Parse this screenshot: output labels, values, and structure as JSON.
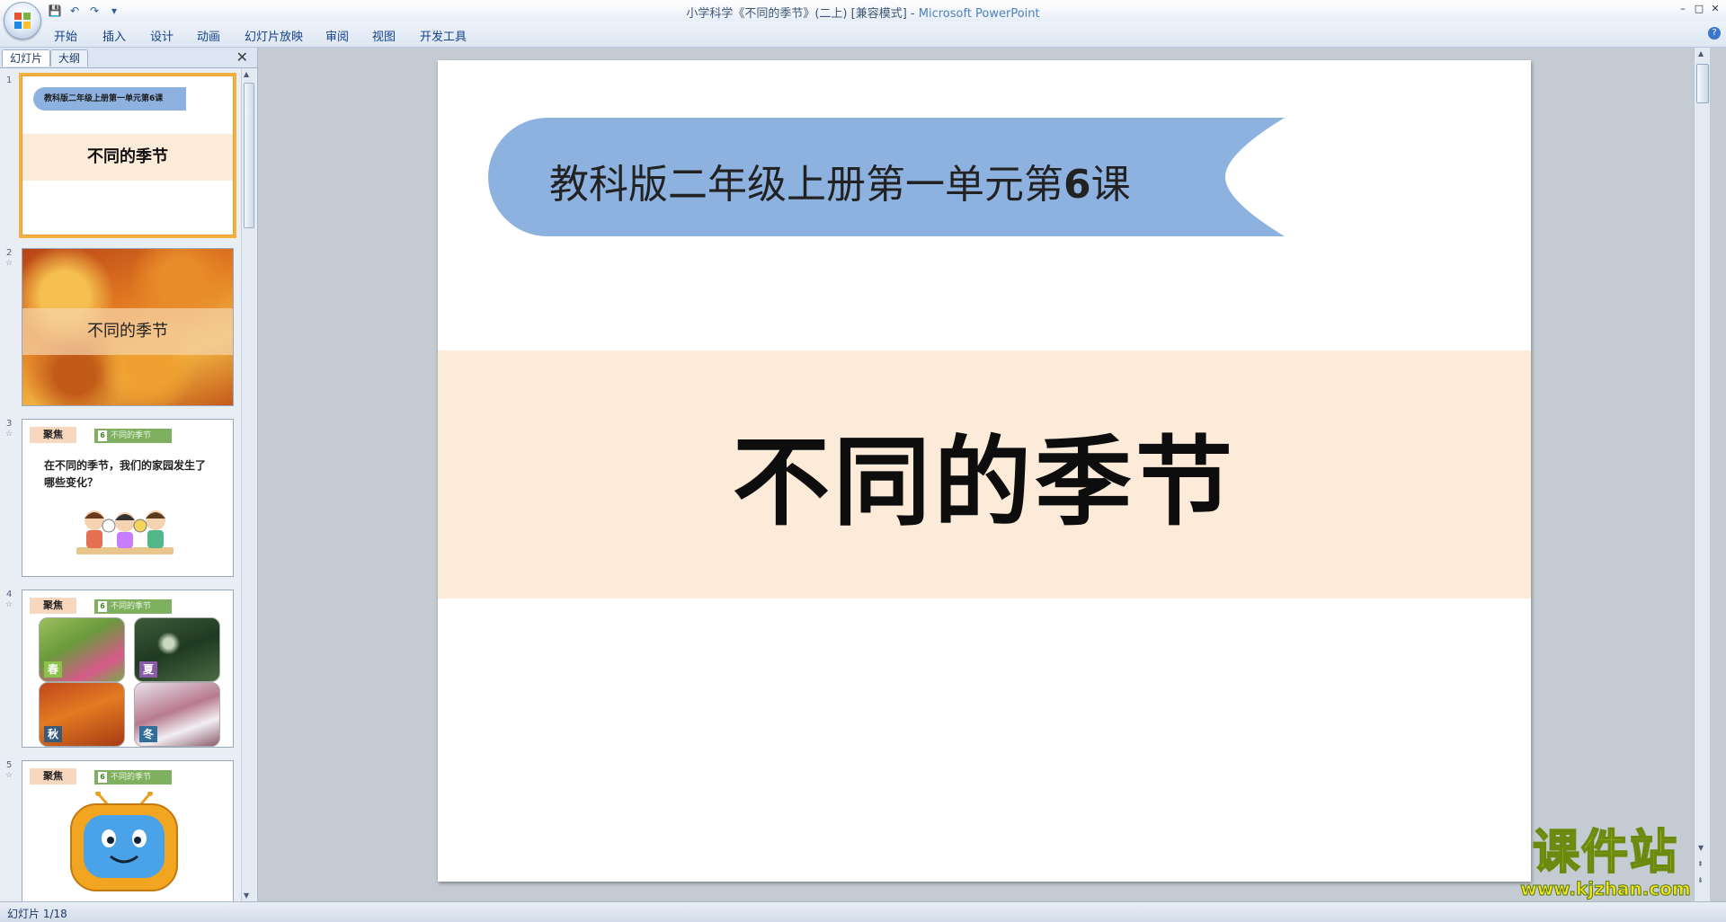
{
  "window": {
    "title": "小学科学《不同的季节》(二上) [兼容模式] - ",
    "app_name": "Microsoft PowerPoint",
    "minimize": "–",
    "maximize": "□",
    "close": "✕"
  },
  "quick_access": {
    "save": "💾",
    "undo": "↶",
    "redo": "↷",
    "customize": "▾"
  },
  "ribbon": {
    "tabs": [
      "开始",
      "插入",
      "设计",
      "动画",
      "幻灯片放映",
      "审阅",
      "视图",
      "开发工具"
    ],
    "help": "?"
  },
  "left_pane": {
    "tabs": [
      "幻灯片",
      "大纲"
    ],
    "close": "✕",
    "slides": [
      {
        "number": "1",
        "ribbon_text": "教科版二年级上册第一单元第6课",
        "title": "不同的季节"
      },
      {
        "number": "2",
        "title": "不同的季节"
      },
      {
        "number": "3",
        "focus_tag": "聚焦",
        "title_tag_num": "6",
        "title_tag": "不同的季节",
        "question": "在不同的季节，我们的家园发生了哪些变化？"
      },
      {
        "number": "4",
        "focus_tag": "聚焦",
        "title_tag_num": "6",
        "title_tag": "不同的季节",
        "season_labels": [
          "春",
          "夏",
          "秋",
          "冬"
        ]
      },
      {
        "number": "5",
        "focus_tag": "聚焦",
        "title_tag_num": "6",
        "title_tag": "不同的季节"
      }
    ]
  },
  "slide": {
    "subtitle_prefix": "教科版二年级上册第一单元第",
    "subtitle_num": "6",
    "subtitle_suffix": "课",
    "title": "不同的季节",
    "ribbon_color": "#8eb2e0",
    "band_color": "#fcebd9"
  },
  "watermark": {
    "cn": "课件站",
    "url": "www.kjzhan.com"
  },
  "status": {
    "slide_indicator": "幻灯片 1/18"
  }
}
